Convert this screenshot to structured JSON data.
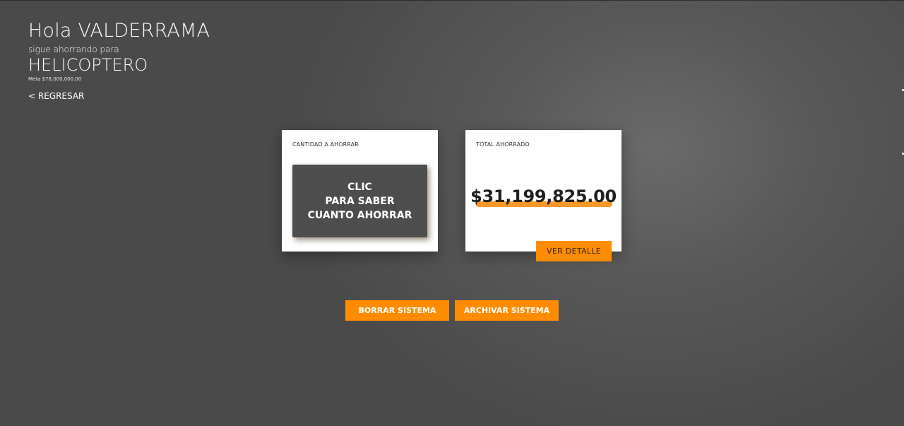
{
  "header": {
    "greeting": "Hola VALDERRAMA",
    "subtitle": "sigue ahorrando para",
    "goal_name": "HELICOPTERO",
    "goal_meta": "Meta $78,000,000.00",
    "back_label": "< REGRESAR"
  },
  "card_amount": {
    "label": "CANTIDAD A AHORRAR",
    "button_lines": [
      "CLIC",
      "PARA SABER",
      "CUANTO AHORRAR"
    ]
  },
  "card_total": {
    "label": "TOTAL AHORRADO",
    "value": "$31,199,825.00",
    "detail_label": "VER DETALLE"
  },
  "actions": {
    "delete_label": "BORRAR SISTEMA",
    "archive_label": "ARCHIVAR SISTEMA"
  },
  "colors": {
    "accent": "#ff8c00",
    "dark_button": "#4e4d4d",
    "background": "#555555"
  }
}
